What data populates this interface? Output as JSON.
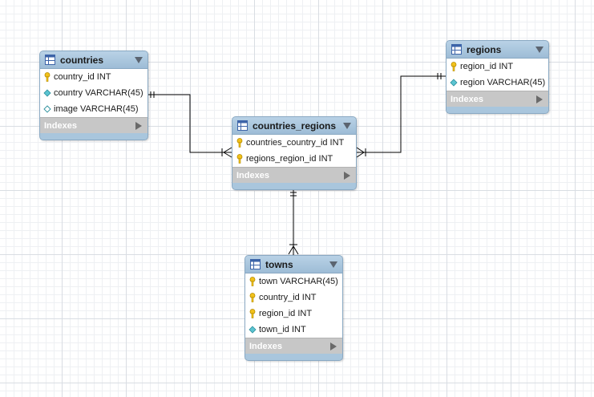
{
  "entities": {
    "countries": {
      "title": "countries",
      "columns": [
        {
          "text": "country_id INT",
          "icon": "key-icon"
        },
        {
          "text": "country VARCHAR(45)",
          "icon": "diamond-filled-icon"
        },
        {
          "text": "image VARCHAR(45)",
          "icon": "diamond-empty-icon"
        }
      ],
      "indexes_label": "Indexes"
    },
    "regions": {
      "title": "regions",
      "columns": [
        {
          "text": "region_id INT",
          "icon": "key-icon"
        },
        {
          "text": "region VARCHAR(45)",
          "icon": "diamond-filled-icon"
        }
      ],
      "indexes_label": "Indexes"
    },
    "countries_regions": {
      "title": "countries_regions",
      "columns": [
        {
          "text": "countries_country_id INT",
          "icon": "key-icon"
        },
        {
          "text": "regions_region_id INT",
          "icon": "key-icon"
        }
      ],
      "indexes_label": "Indexes"
    },
    "towns": {
      "title": "towns",
      "columns": [
        {
          "text": "town VARCHAR(45)",
          "icon": "key-icon"
        },
        {
          "text": "country_id INT",
          "icon": "key-icon"
        },
        {
          "text": "region_id INT",
          "icon": "key-icon"
        },
        {
          "text": "town_id INT",
          "icon": "diamond-filled-icon"
        }
      ],
      "indexes_label": "Indexes"
    }
  },
  "relationships": [
    {
      "from": "countries",
      "to": "countries_regions",
      "from_end": "one-and-only-one",
      "to_end": "one-or-many"
    },
    {
      "from": "regions",
      "to": "countries_regions",
      "from_end": "one-and-only-one",
      "to_end": "one-or-many"
    },
    {
      "from": "countries_regions",
      "to": "towns",
      "from_end": "one-and-only-one",
      "to_end": "one-or-many"
    }
  ],
  "colors": {
    "header": "#a9c6dd",
    "indexes_bar": "#c7c7c7",
    "key_icon": "#f2c21b",
    "diamond_icon": "#5bc4d1",
    "connector": "#000000"
  }
}
